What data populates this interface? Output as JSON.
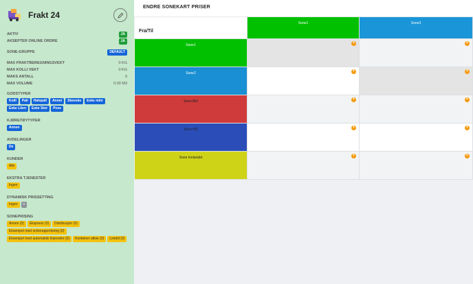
{
  "sidebar": {
    "title": "Frakt 24",
    "aktiv_label": "AKTIV",
    "aktiv_value": "JA",
    "online_label": "AKSEPTER ONLINE ORDRE",
    "online_value": "JA",
    "sone_gruppe_label": "SONE-GRUPPE",
    "sone_gruppe_value": "DEFAULT",
    "stats": [
      {
        "label": "MAX FRAKTBEREGNINGSVEKT",
        "value": "0 KG"
      },
      {
        "label": "MAX KOLLI VEKT",
        "value": "0 KG"
      },
      {
        "label": "MAKS ANTALL",
        "value": "0"
      },
      {
        "label": "MAX VOLUME",
        "value": "0.00 M3"
      }
    ],
    "godstyper_label": "GODSTYPER",
    "godstyper": [
      "Kolli",
      "Pall",
      "Halvpall",
      "Annet",
      "Skeeske",
      "Eske mini",
      "Eske Liten",
      "Eske Stor",
      "Pose"
    ],
    "kjoretoytyper_label": "KJØRETØYTYPER",
    "kjoretoytyper": [
      "Annen"
    ],
    "avdelinger_label": "AVDELINGER",
    "avdelinger": [
      "De"
    ],
    "kunder_label": "KUNDER",
    "kunder": [
      "Alle"
    ],
    "ekstra_label": "EKSTRA TJENESTER",
    "ekstra": [
      "Ingen"
    ],
    "dynamisk_label": "DYNAMISK PRISSETTING",
    "dynamisk": [
      "Ingen"
    ],
    "dynamisk_add": "+",
    "soneprising_label": "SONEPRISING",
    "soneprising": [
      "Annen (0)",
      "Ekspress (0)",
      "Distribusjon (0)",
      "Eksempel med ordrerapportering (0)",
      "Eksempel med automatisk linjeordre (0)",
      "Konteiner utleie (0)",
      "Leiebil (0)"
    ]
  },
  "main": {
    "title": "ENDRE SONEKART PRISER",
    "corner_label": "Fra/Til",
    "columns": [
      {
        "name": "Sone1",
        "color": "#00c000"
      },
      {
        "name": "Sone3",
        "color": "#1a95d8"
      }
    ],
    "rows": [
      {
        "name": "Sone1",
        "color": "#00c000",
        "text_color": "#ffffff",
        "cells": [
          "grey",
          "light"
        ]
      },
      {
        "name": "Sone2",
        "color": "#1a8fd3",
        "text_color": "#ffffff",
        "cells": [
          "white",
          "grey"
        ]
      },
      {
        "name": "Sone Øst",
        "color": "#cf3b3b",
        "text_color": "#222222",
        "cells": [
          "light",
          "light"
        ]
      },
      {
        "name": "Sone HQ",
        "color": "#2b4db8",
        "text_color": "#222222",
        "cells": [
          "white",
          "white"
        ]
      },
      {
        "name": "Sone Innlandet",
        "color": "#cfd318",
        "text_color": "#222222",
        "cells": [
          "light",
          "light"
        ]
      }
    ],
    "add_icon": "plus-circle-icon",
    "accent": "#f59a0b"
  }
}
